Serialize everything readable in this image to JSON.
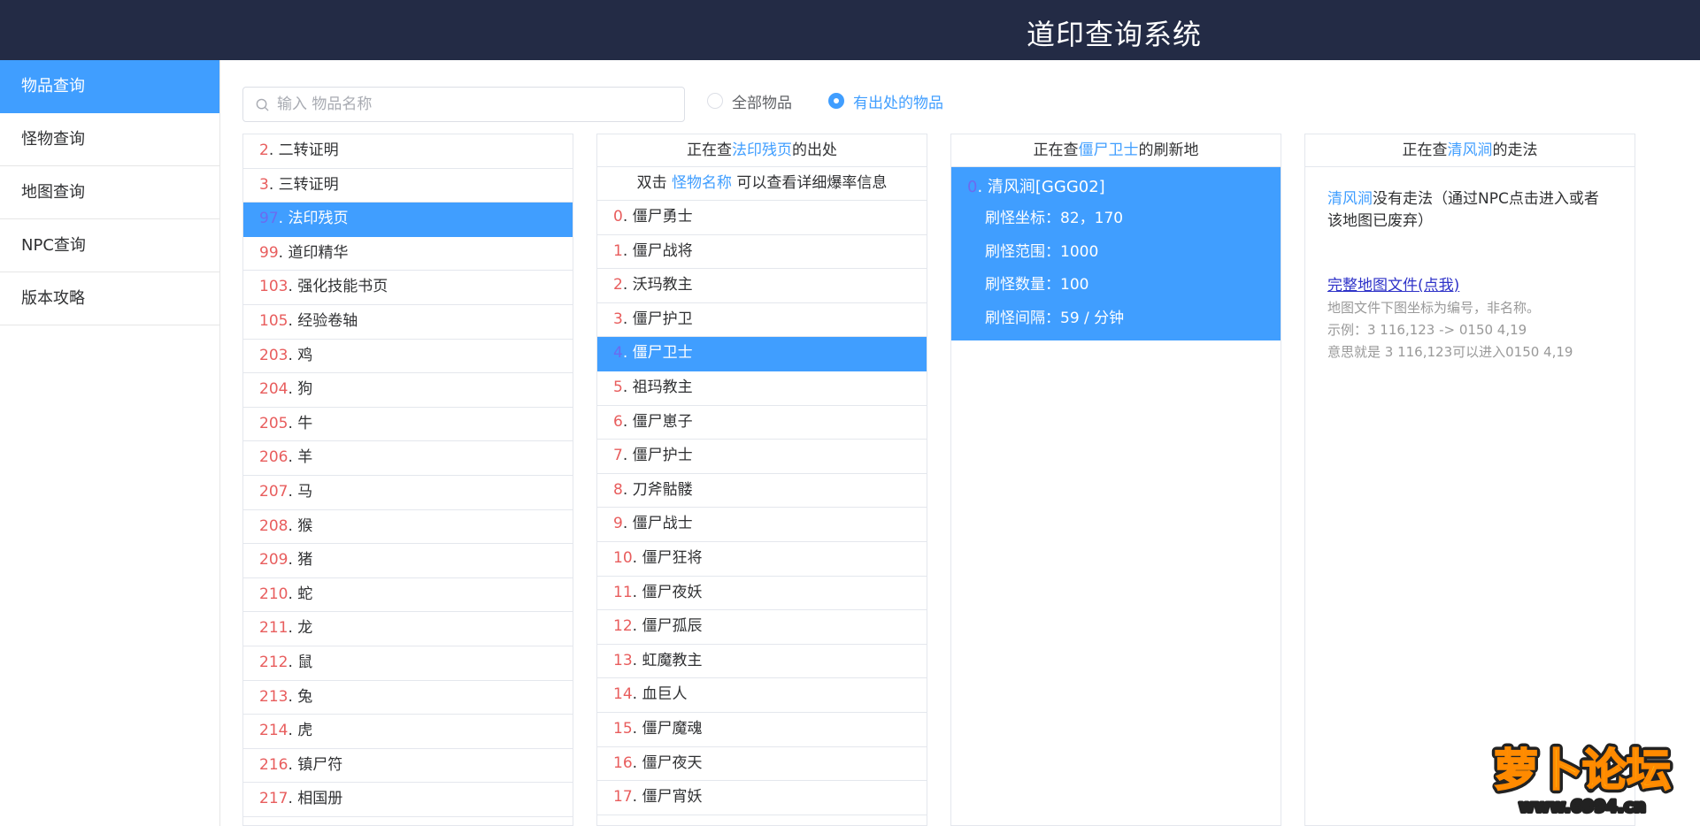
{
  "header": {
    "title": "道印查询系统"
  },
  "sidebar": {
    "items": [
      {
        "label": "物品查询",
        "active": true
      },
      {
        "label": "怪物查询",
        "active": false
      },
      {
        "label": "地图查询",
        "active": false
      },
      {
        "label": "NPC查询",
        "active": false
      },
      {
        "label": "版本攻略",
        "active": false
      }
    ]
  },
  "search": {
    "placeholder": "输入 物品名称",
    "value": ""
  },
  "filters": {
    "all_label": "全部物品",
    "source_label": "有出处的物品",
    "selected": "有出处的物品"
  },
  "items_panel": {
    "rows": [
      {
        "num": "2",
        "name": "二转证明",
        "selected": false
      },
      {
        "num": "3",
        "name": "三转证明",
        "selected": false
      },
      {
        "num": "97",
        "name": "法印残页",
        "selected": true
      },
      {
        "num": "99",
        "name": "道印精华",
        "selected": false
      },
      {
        "num": "103",
        "name": "强化技能书页",
        "selected": false
      },
      {
        "num": "105",
        "name": "经验卷轴",
        "selected": false
      },
      {
        "num": "203",
        "name": "鸡",
        "selected": false
      },
      {
        "num": "204",
        "name": "狗",
        "selected": false
      },
      {
        "num": "205",
        "name": "牛",
        "selected": false
      },
      {
        "num": "206",
        "name": "羊",
        "selected": false
      },
      {
        "num": "207",
        "name": "马",
        "selected": false
      },
      {
        "num": "208",
        "name": "猴",
        "selected": false
      },
      {
        "num": "209",
        "name": "猪",
        "selected": false
      },
      {
        "num": "210",
        "name": "蛇",
        "selected": false
      },
      {
        "num": "211",
        "name": "龙",
        "selected": false
      },
      {
        "num": "212",
        "name": "鼠",
        "selected": false
      },
      {
        "num": "213",
        "name": "兔",
        "selected": false
      },
      {
        "num": "214",
        "name": "虎",
        "selected": false
      },
      {
        "num": "216",
        "name": "镇尸符",
        "selected": false
      },
      {
        "num": "217",
        "name": "相国册",
        "selected": false
      }
    ]
  },
  "monsters_panel": {
    "head_prefix": "正在查",
    "head_item": "法印残页",
    "head_suffix": "的出处",
    "hint_prefix": "双击 ",
    "hint_link": "怪物名称",
    "hint_suffix": " 可以查看详细爆率信息",
    "rows": [
      {
        "num": "0",
        "name": "僵尸勇士",
        "selected": false
      },
      {
        "num": "1",
        "name": "僵尸战将",
        "selected": false
      },
      {
        "num": "2",
        "name": "沃玛教主",
        "selected": false
      },
      {
        "num": "3",
        "name": "僵尸护卫",
        "selected": false
      },
      {
        "num": "4",
        "name": "僵尸卫士",
        "selected": true
      },
      {
        "num": "5",
        "name": "祖玛教主",
        "selected": false
      },
      {
        "num": "6",
        "name": "僵尸崽子",
        "selected": false
      },
      {
        "num": "7",
        "name": "僵尸护士",
        "selected": false
      },
      {
        "num": "8",
        "name": "刀斧骷髅",
        "selected": false
      },
      {
        "num": "9",
        "name": "僵尸战士",
        "selected": false
      },
      {
        "num": "10",
        "name": "僵尸狂将",
        "selected": false
      },
      {
        "num": "11",
        "name": "僵尸夜妖",
        "selected": false
      },
      {
        "num": "12",
        "name": "僵尸孤辰",
        "selected": false
      },
      {
        "num": "13",
        "name": "虹魔教主",
        "selected": false
      },
      {
        "num": "14",
        "name": "血巨人",
        "selected": false
      },
      {
        "num": "15",
        "name": "僵尸魔魂",
        "selected": false
      },
      {
        "num": "16",
        "name": "僵尸夜天",
        "selected": false
      },
      {
        "num": "17",
        "name": "僵尸宵妖",
        "selected": false
      }
    ]
  },
  "spawn_panel": {
    "head_prefix": "正在查",
    "head_monster": "僵尸卫士",
    "head_suffix": "的刷新地",
    "entry_num": "0",
    "entry_name": "清风涧[GGG02]",
    "coords": "刷怪坐标：82，170",
    "range": "刷怪范围：1000",
    "count": "刷怪数量：100",
    "interval": "刷怪间隔：59 / 分钟"
  },
  "route_panel": {
    "head_prefix": "正在查",
    "head_map": "清风涧",
    "head_suffix": "的走法",
    "map_name": "清风涧",
    "no_route_text": "没有走法（通过NPC点击进入或者该地图已废弃）",
    "file_link": "完整地图文件(点我)",
    "note1": "地图文件下图坐标为编号，非名称。",
    "note2": "示例：3 116,123 -> 0150 4,19",
    "note3": "意思就是 3 116,123可以进入0150 4,19"
  },
  "watermark": {
    "brand": "萝卜论坛",
    "url": "www.6994.cn"
  },
  "colors": {
    "header_bg": "#232b45",
    "accent": "#409eff",
    "index_red": "#e85d5d"
  }
}
